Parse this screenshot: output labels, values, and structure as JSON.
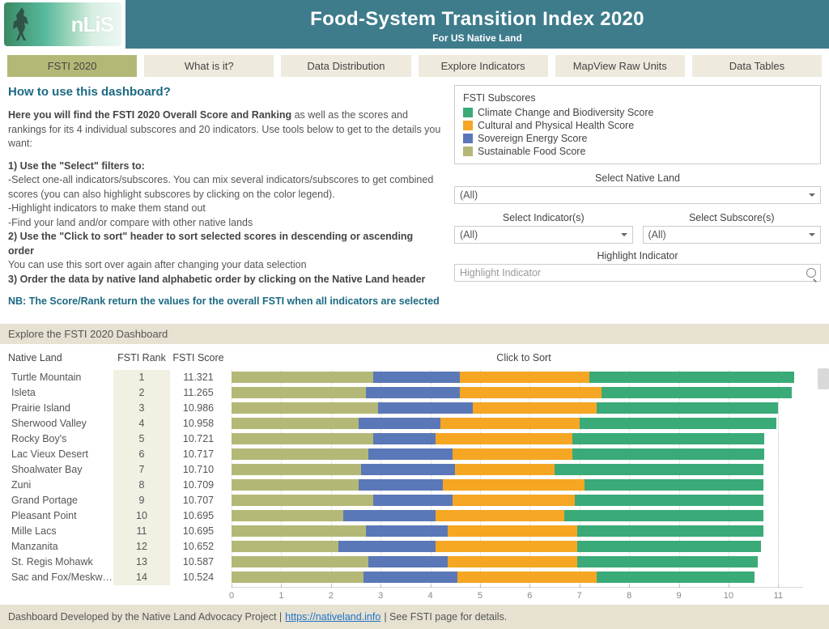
{
  "banner": {
    "logo_text": "nLiS",
    "title": "Food-System Transition Index 2020",
    "subtitle": "For US Native Land"
  },
  "tabs": [
    {
      "label": "FSTI 2020",
      "active": true
    },
    {
      "label": "What is it?",
      "active": false
    },
    {
      "label": "Data Distribution",
      "active": false
    },
    {
      "label": "Explore Indicators",
      "active": false
    },
    {
      "label": "MapView Raw Units",
      "active": false
    },
    {
      "label": "Data Tables",
      "active": false
    }
  ],
  "howto": {
    "title": "How to use this dashboard?",
    "intro_bold": "Here you will find the FSTI 2020 Overall Score and Ranking",
    "intro_rest": " as well as the scores and rankings for its 4 individual subscores and 20 indicators. Use tools below to get to the details you want:",
    "l1": "1) Use the \"Select\" filters to:",
    "l1a": "-Select one-all indicators/subscores. You can mix several indicators/subscores to get combined scores (you can also highlight subscores by clicking on the color legend).",
    "l1b": "-Highlight indicators to make them stand out",
    "l1c": "-Find your land and/or compare with other native lands",
    "l2": "2) Use the \"Click to sort\" header to sort selected scores in descending or ascending order",
    "l2a": "You can use this sort over again after changing your data selection",
    "l3": "3) Order the data by native land alphabetic order by clicking on the Native Land header",
    "note": "NB: The Score/Rank return the values for the overall FSTI when all indicators are selected"
  },
  "legend": {
    "title": "FSTI Subscores",
    "items": [
      {
        "label": "Climate Change and Biodiversity Score",
        "color": "#3aab78"
      },
      {
        "label": "Cultural and Physical Health Score",
        "color": "#f5a623"
      },
      {
        "label": "Sovereign Energy Score",
        "color": "#5a78b8"
      },
      {
        "label": "Sustainable Food Score",
        "color": "#b4b876"
      }
    ]
  },
  "controls": {
    "native_label": "Select Native Land",
    "native_value": "(All)",
    "indicator_label": "Select Indicator(s)",
    "indicator_value": "(All)",
    "subscore_label": "Select Subscore(s)",
    "subscore_value": "(All)",
    "highlight_label": "Highlight Indicator",
    "highlight_placeholder": "Highlight Indicator"
  },
  "explore_title": "Explore the FSTI 2020 Dashboard",
  "headers": {
    "native": "Native Land",
    "rank": "FSTI Rank",
    "score": "FSTI Score",
    "sort": "Click to Sort"
  },
  "chart_data": {
    "type": "bar",
    "stacked": true,
    "x_axis": {
      "min": 0,
      "max": 11.5,
      "ticks": [
        0,
        1,
        2,
        3,
        4,
        5,
        6,
        7,
        8,
        9,
        10,
        11
      ]
    },
    "series_order": [
      "Sustainable Food Score",
      "Sovereign Energy Score",
      "Cultural and Physical Health Score",
      "Climate Change and Biodiversity Score"
    ],
    "colors": {
      "Sustainable Food Score": "#b4b876",
      "Sovereign Energy Score": "#5a78b8",
      "Cultural and Physical Health Score": "#f5a623",
      "Climate Change and Biodiversity Score": "#3aab78"
    },
    "rows": [
      {
        "native": "Turtle Mountain",
        "rank": 1,
        "score": "11.321",
        "segments": [
          2.85,
          1.75,
          2.6,
          4.12
        ]
      },
      {
        "native": "Isleta",
        "rank": 2,
        "score": "11.265",
        "segments": [
          2.7,
          1.9,
          2.85,
          3.82
        ]
      },
      {
        "native": "Prairie Island",
        "rank": 3,
        "score": "10.986",
        "segments": [
          2.95,
          1.9,
          2.5,
          3.64
        ]
      },
      {
        "native": "Sherwood Valley",
        "rank": 4,
        "score": "10.958",
        "segments": [
          2.55,
          1.65,
          2.8,
          3.96
        ]
      },
      {
        "native": "Rocky Boy's",
        "rank": 5,
        "score": "10.721",
        "segments": [
          2.85,
          1.25,
          2.75,
          3.87
        ]
      },
      {
        "native": "Lac Vieux Desert",
        "rank": 6,
        "score": "10.717",
        "segments": [
          2.75,
          1.7,
          2.4,
          3.87
        ]
      },
      {
        "native": "Shoalwater Bay",
        "rank": 7,
        "score": "10.710",
        "segments": [
          2.6,
          1.9,
          2.0,
          4.21
        ]
      },
      {
        "native": "Zuni",
        "rank": 8,
        "score": "10.709",
        "segments": [
          2.55,
          1.7,
          2.85,
          3.61
        ]
      },
      {
        "native": "Grand Portage",
        "rank": 9,
        "score": "10.707",
        "segments": [
          2.85,
          1.6,
          2.45,
          3.81
        ]
      },
      {
        "native": "Pleasant Point",
        "rank": 10,
        "score": "10.695",
        "segments": [
          2.25,
          1.85,
          2.6,
          4.0
        ]
      },
      {
        "native": "Mille Lacs",
        "rank": 11,
        "score": "10.695",
        "segments": [
          2.7,
          1.65,
          2.6,
          3.75
        ]
      },
      {
        "native": "Manzanita",
        "rank": 12,
        "score": "10.652",
        "segments": [
          2.15,
          1.95,
          2.85,
          3.7
        ]
      },
      {
        "native": "St. Regis Mohawk",
        "rank": 13,
        "score": "10.587",
        "segments": [
          2.75,
          1.6,
          2.6,
          3.64
        ]
      },
      {
        "native": "Sac and Fox/Meskwaki",
        "rank": 14,
        "score": "10.524",
        "segments": [
          2.65,
          1.9,
          2.8,
          3.17
        ]
      }
    ]
  },
  "footer": {
    "pre": "Dashboard Developed by the Native Land Advocacy Project | ",
    "link": "https://nativeland.info",
    "post": " | See FSTI page for details."
  }
}
